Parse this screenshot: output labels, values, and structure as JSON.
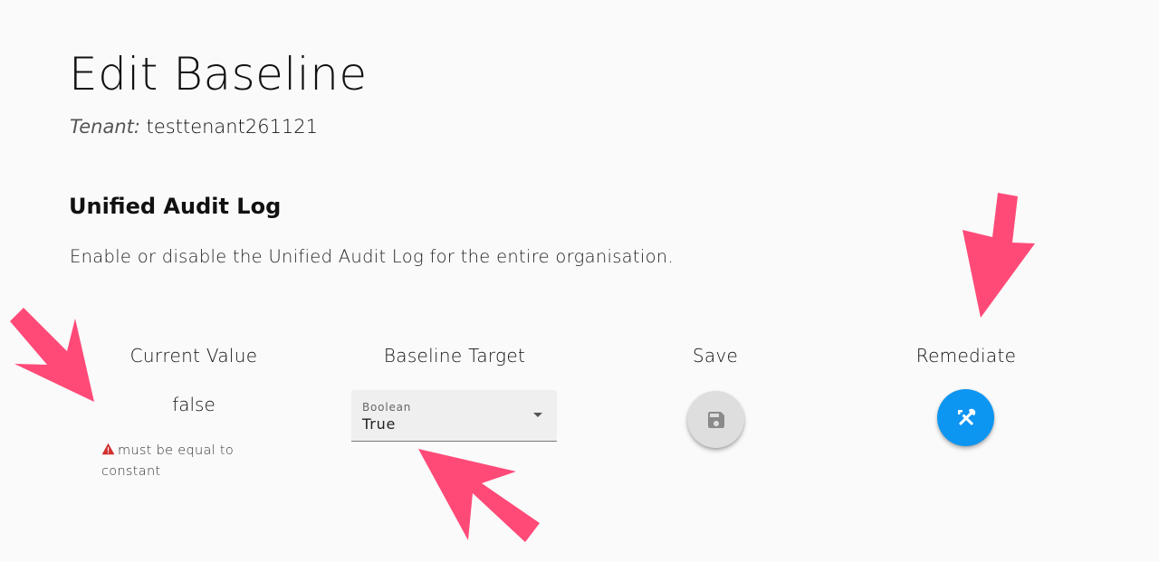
{
  "page": {
    "title": "Edit Baseline",
    "tenant_label": "Tenant:",
    "tenant_value": "testtenant261121"
  },
  "setting": {
    "name": "Unified Audit Log",
    "description": "Enable or disable the Unified Audit Log for the entire organisation."
  },
  "columns": {
    "current_value": "Current Value",
    "baseline_target": "Baseline Target",
    "save": "Save",
    "remediate": "Remediate"
  },
  "current": {
    "value": "false",
    "error": "must be equal to constant"
  },
  "target_select": {
    "label": "Boolean",
    "value": "True"
  },
  "icons": {
    "warning": "warning-icon",
    "save": "floppy-disk-icon",
    "remediate": "tools-icon",
    "dropdown": "caret-down-icon"
  },
  "colors": {
    "accent": "#0d95f2",
    "save_button": "#dedede",
    "annotation_arrow": "#ff4a78",
    "warning": "#d32f2f"
  }
}
